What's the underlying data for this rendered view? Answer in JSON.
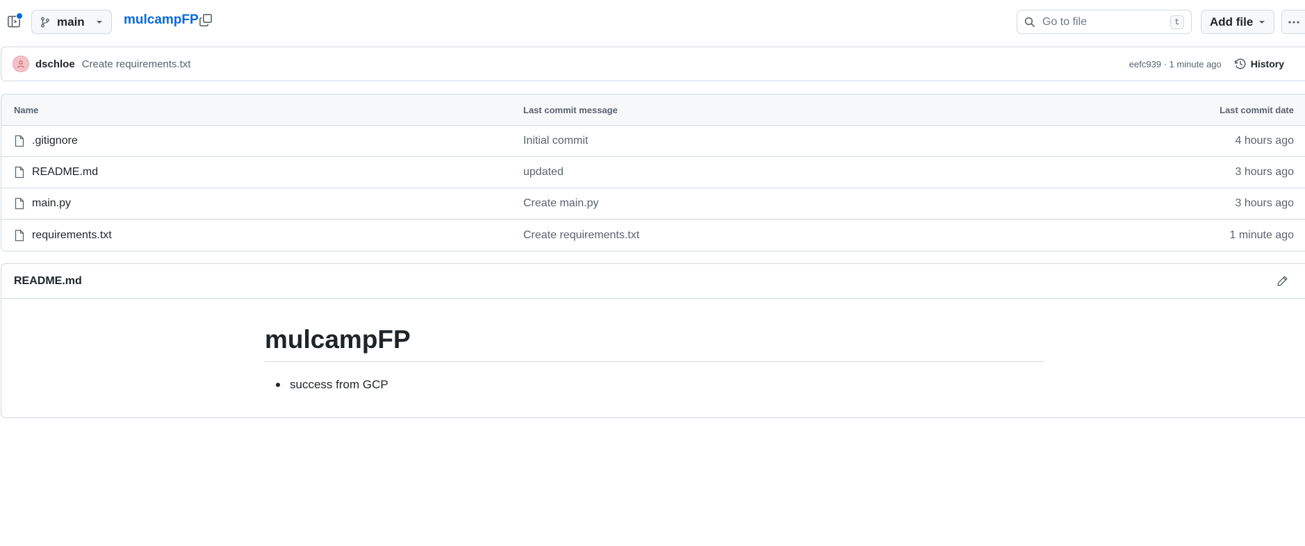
{
  "header": {
    "branch": "main",
    "repo_name": "mulcampFP",
    "search": {
      "placeholder": "Go to file",
      "shortcut": "t"
    },
    "add_file_label": "Add file"
  },
  "latest_commit": {
    "author": "dschloe",
    "message": "Create requirements.txt",
    "meta": "eefc939 · 1 minute ago",
    "history_label": "History"
  },
  "file_table": {
    "columns": [
      "Name",
      "Last commit message",
      "Last commit date"
    ],
    "rows": [
      {
        "name": ".gitignore",
        "message": "Initial commit",
        "date": "4 hours ago"
      },
      {
        "name": "README.md",
        "message": "updated",
        "date": "3 hours ago"
      },
      {
        "name": "main.py",
        "message": "Create main.py",
        "date": "3 hours ago"
      },
      {
        "name": "requirements.txt",
        "message": "Create requirements.txt",
        "date": "1 minute ago"
      }
    ]
  },
  "readme": {
    "filename": "README.md",
    "title": "mulcampFP",
    "items": [
      "success from GCP"
    ]
  },
  "colors": {
    "link": "#0969da",
    "border": "#d1d9e0",
    "muted_text": "#59636e",
    "header_bg": "#f6f8fa"
  },
  "icons": [
    "sidebar-toggle-icon",
    "branch-icon",
    "chevron-down-icon",
    "copy-icon",
    "search-icon",
    "kebab-icon",
    "history-icon",
    "file-icon",
    "pencil-icon"
  ]
}
